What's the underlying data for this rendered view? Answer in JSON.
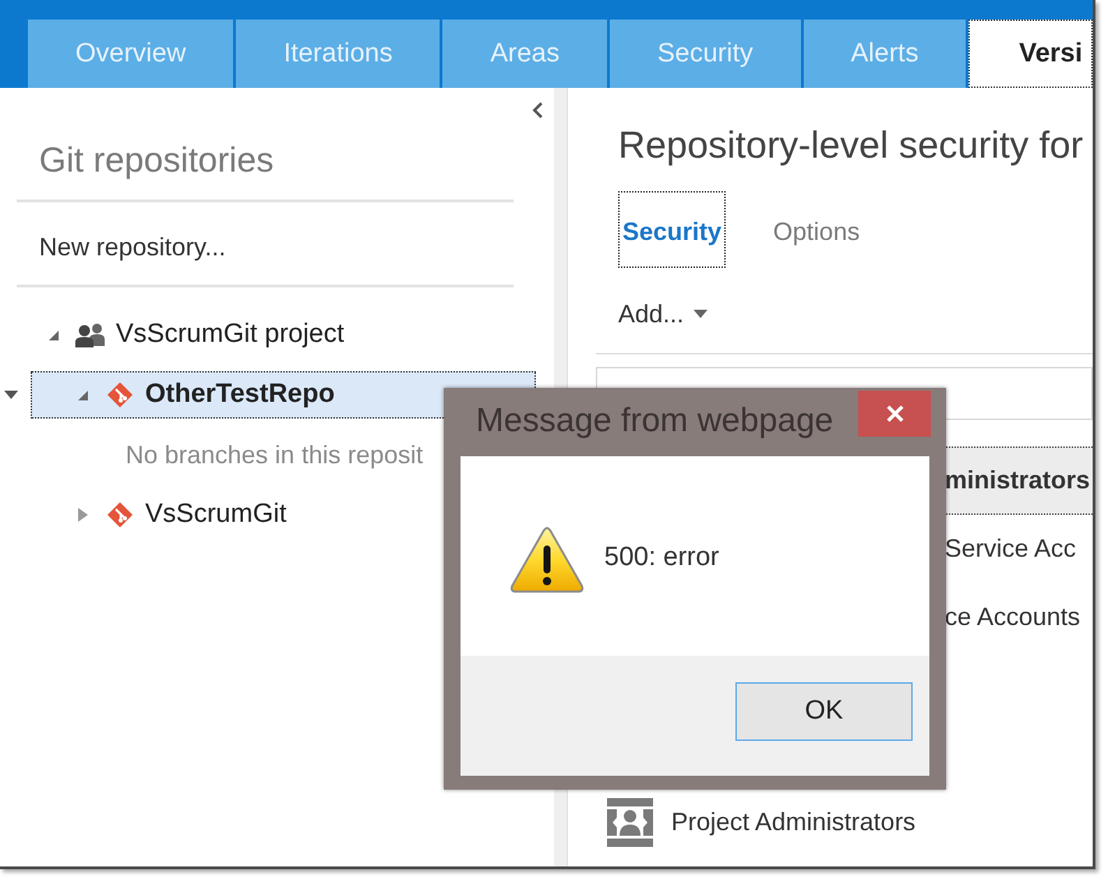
{
  "tabs": [
    {
      "label": "Overview",
      "selected": false
    },
    {
      "label": "Iterations",
      "selected": false
    },
    {
      "label": "Areas",
      "selected": false
    },
    {
      "label": "Security",
      "selected": false
    },
    {
      "label": "Alerts",
      "selected": false
    },
    {
      "label": "Versi",
      "selected": true
    }
  ],
  "sidebar": {
    "title": "Git repositories",
    "new_repository": "New repository...",
    "tree": [
      {
        "kind": "project",
        "label": "VsScrumGit project",
        "expanded": true,
        "selected": false,
        "children": [
          {
            "kind": "repo",
            "label": "OtherTestRepo",
            "expanded": true,
            "selected": true,
            "children": [
              {
                "kind": "message",
                "label": "No branches in this reposit"
              }
            ]
          },
          {
            "kind": "repo",
            "label": "VsScrumGit",
            "expanded": false,
            "selected": false
          }
        ]
      }
    ]
  },
  "main": {
    "title": "Repository-level security for",
    "tabs": [
      {
        "label": "Security",
        "selected": true
      },
      {
        "label": "Options",
        "selected": false
      }
    ],
    "add_menu": "Add...",
    "groups": [
      {
        "kind": "clipped",
        "label": "ministrators",
        "selected": true
      },
      {
        "kind": "clipped",
        "label": "Service Acc",
        "selected": false
      },
      {
        "kind": "clipped",
        "label": "ce Accounts",
        "selected": false
      },
      {
        "kind": "full",
        "label": "Project Administrators",
        "selected": false
      }
    ]
  },
  "dialog": {
    "title": "Message from webpage",
    "message": "500: error",
    "buttons": [
      "OK"
    ]
  }
}
